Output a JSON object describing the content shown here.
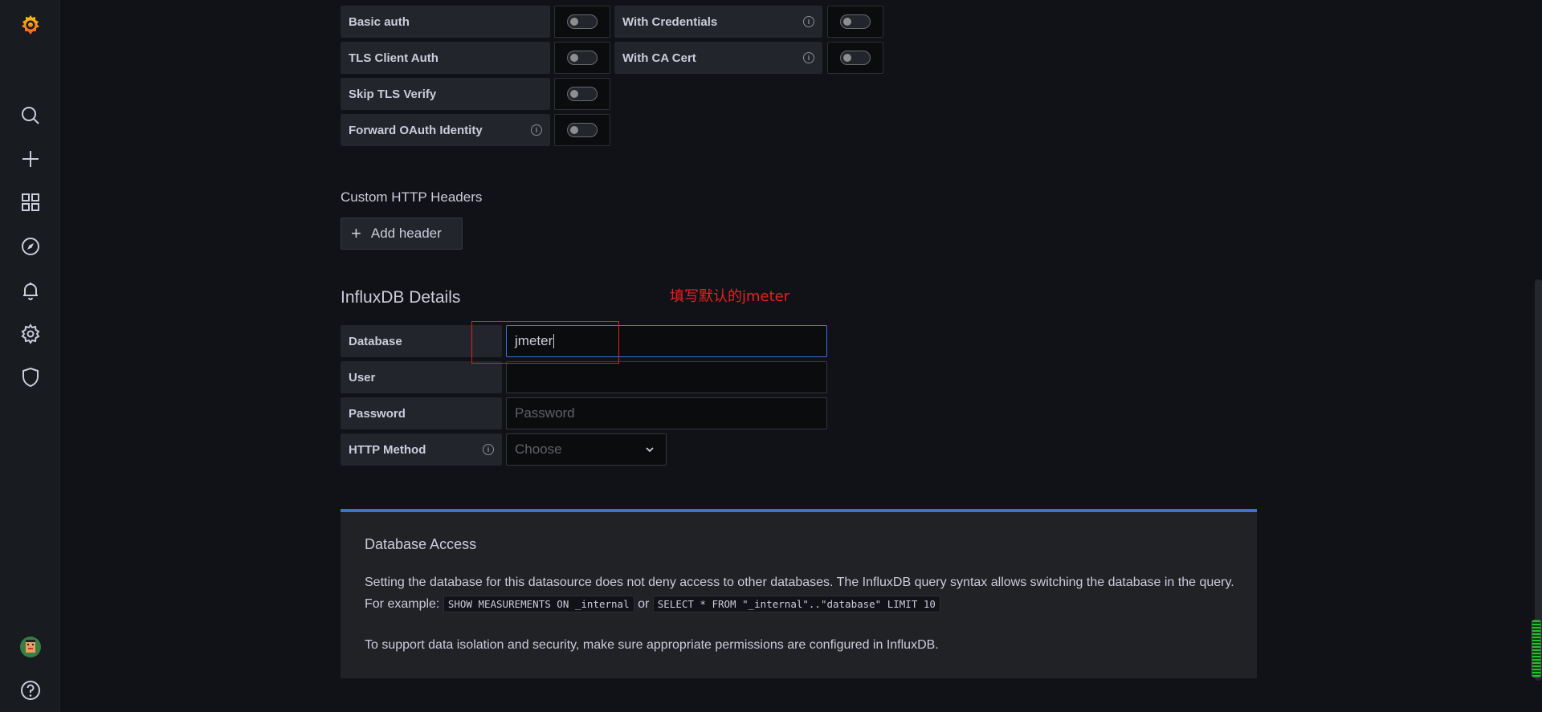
{
  "sidebar": {
    "logo": "grafana-logo-icon",
    "items": [
      {
        "icon": "search-icon"
      },
      {
        "icon": "plus-icon"
      },
      {
        "icon": "dashboards-icon"
      },
      {
        "icon": "explore-icon"
      },
      {
        "icon": "alerting-bell-icon"
      },
      {
        "icon": "configuration-gear-icon"
      },
      {
        "icon": "server-admin-shield-icon"
      }
    ],
    "avatar": "user-avatar",
    "help": "help-icon"
  },
  "auth": {
    "basic_auth": "Basic auth",
    "with_credentials": "With Credentials",
    "tls_client_auth": "TLS Client Auth",
    "with_ca_cert": "With CA Cert",
    "skip_tls_verify": "Skip TLS Verify",
    "forward_oauth": "Forward OAuth Identity"
  },
  "headers": {
    "title": "Custom HTTP Headers",
    "add_label": "Add header"
  },
  "influx": {
    "title": "InfluxDB Details",
    "database_label": "Database",
    "database_value": "jmeter",
    "user_label": "User",
    "user_value": "",
    "password_label": "Password",
    "password_placeholder": "Password",
    "http_method_label": "HTTP Method",
    "http_method_placeholder": "Choose"
  },
  "annotation": {
    "text": "填写默认的jmeter",
    "color": "#e02020"
  },
  "access_info": {
    "title": "Database Access",
    "p1_text": "Setting the database for this datasource does not deny access to other databases. The InfluxDB query syntax allows switching the database in the query. For example:",
    "code1": "SHOW MEASUREMENTS ON _internal",
    "or": "or",
    "code2": "SELECT * FROM \"_internal\"..\"database\" LIMIT 10",
    "p2_text": "To support data isolation and security, make sure appropriate permissions are configured in InfluxDB."
  },
  "colors": {
    "background": "#111217",
    "panel": "#22252b",
    "accent": "#3d71d9"
  }
}
